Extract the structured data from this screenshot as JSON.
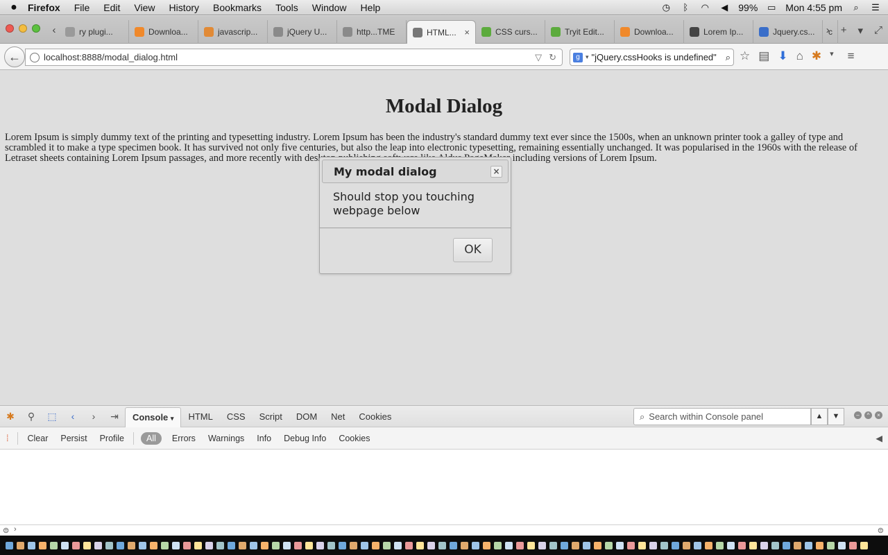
{
  "menubar": {
    "app": "Firefox",
    "items": [
      "File",
      "Edit",
      "View",
      "History",
      "Bookmarks",
      "Tools",
      "Window",
      "Help"
    ],
    "battery": "99%",
    "clock": "Mon 4:55 pm"
  },
  "tabs": [
    {
      "label": "ry plugi...",
      "color": "#9a9a9a"
    },
    {
      "label": "Downloa...",
      "color": "#f0892b"
    },
    {
      "label": "javascrip...",
      "color": "#e18a36"
    },
    {
      "label": "jQuery U...",
      "color": "#8a8a8a"
    },
    {
      "label": "http...TME",
      "color": "#8a8a8a"
    },
    {
      "label": "HTML...",
      "color": "#777777",
      "active": true
    },
    {
      "label": "CSS curs...",
      "color": "#5cab3d"
    },
    {
      "label": "Tryit Edit...",
      "color": "#5cab3d"
    },
    {
      "label": "Downloa...",
      "color": "#f0892b"
    },
    {
      "label": "Lorem Ip...",
      "color": "#444444"
    },
    {
      "label": "Jquery.cs...",
      "color": "#3a6ec9"
    },
    {
      "label": "c",
      "color": "#999999"
    }
  ],
  "navbar": {
    "url": "localhost:8888/modal_dialog.html",
    "search_value": "\"jQuery.cssHooks is undefined\""
  },
  "page": {
    "heading": "Modal Dialog",
    "paragraph": "Lorem Ipsum is simply dummy text of the printing and typesetting industry. Lorem Ipsum has been the industry's standard dummy text ever since the 1500s, when an unknown printer took a galley of type and scrambled it to make a type specimen book. It has survived not only five centuries, but also the leap into electronic typesetting, remaining essentially unchanged. It was popularised in the 1960s with the release of Letraset sheets containing Lorem Ipsum passages, and more recently with desktop publishing software like Aldus PageMaker including versions of Lorem Ipsum."
  },
  "dialog": {
    "title": "My modal dialog",
    "close": "×",
    "body": "Should stop you touching webpage below",
    "ok": "OK"
  },
  "firebug": {
    "tabs": [
      "Console",
      "HTML",
      "CSS",
      "Script",
      "DOM",
      "Net",
      "Cookies"
    ],
    "search_placeholder": "Search within Console panel",
    "filters": [
      "Clear",
      "Persist",
      "Profile"
    ],
    "levels": [
      "All",
      "Errors",
      "Warnings",
      "Info",
      "Debug Info",
      "Cookies"
    ],
    "prompt": "›"
  }
}
